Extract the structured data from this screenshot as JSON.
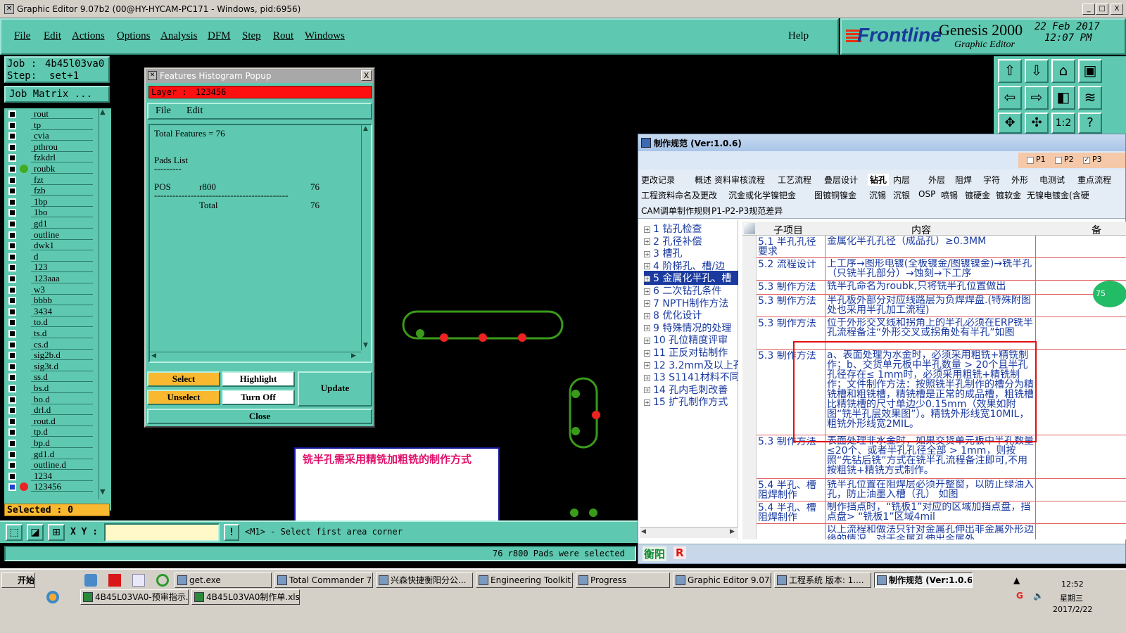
{
  "window": {
    "title": "Graphic Editor 9.07b2 (00@HY-HYCAM-PC171 - Windows, pid:6956)",
    "btn_min": "_",
    "btn_max": "□",
    "btn_close": "X"
  },
  "menu": [
    "File",
    "Edit",
    "Actions",
    "Options",
    "Analysis",
    "DFM",
    "Step",
    "Rout",
    "Windows"
  ],
  "help_label": "Help",
  "logo": {
    "brand": "Frontline",
    "product": "Genesis 2000",
    "subtitle": "Graphic Editor",
    "date": "22 Feb 2017",
    "time": "12:07 PM"
  },
  "job": {
    "job_label": "Job :",
    "job_value": "4b45l03va0",
    "step_label": "Step:",
    "step_value": "set+1",
    "matrix_button": "Job Matrix ..."
  },
  "layers": [
    {
      "name": "rout"
    },
    {
      "name": "tp"
    },
    {
      "name": "cvia"
    },
    {
      "name": "pthrou"
    },
    {
      "name": "fzkdrl"
    },
    {
      "name": "roubk",
      "dot": "#44aa22"
    },
    {
      "name": "fzt"
    },
    {
      "name": "fzb"
    },
    {
      "name": "1bp"
    },
    {
      "name": "1bo"
    },
    {
      "name": "gd1"
    },
    {
      "name": "outline"
    },
    {
      "name": "dwk1"
    },
    {
      "name": "d"
    },
    {
      "name": "123"
    },
    {
      "name": "123aaa"
    },
    {
      "name": "w3"
    },
    {
      "name": "bbbb"
    },
    {
      "name": "3434"
    },
    {
      "name": "to.d"
    },
    {
      "name": "ts.d"
    },
    {
      "name": "cs.d"
    },
    {
      "name": "sig2b.d"
    },
    {
      "name": "sig3t.d"
    },
    {
      "name": "ss.d"
    },
    {
      "name": "bs.d"
    },
    {
      "name": "bo.d"
    },
    {
      "name": "drl.d"
    },
    {
      "name": "rout.d"
    },
    {
      "name": "tp.d"
    },
    {
      "name": "bp.d"
    },
    {
      "name": "gd1.d"
    },
    {
      "name": "outline.d"
    },
    {
      "name": "1234"
    },
    {
      "name": "123456",
      "dot": "#ee2222",
      "active": true
    }
  ],
  "selected_label": "Selected : 0",
  "popup": {
    "title": "Features Histogram Popup",
    "close_x": "X",
    "layer_label": "Layer :",
    "layer_value": "123456",
    "menu_file": "File",
    "menu_edit": "Edit",
    "total_line": "Total Features = 76",
    "pads_list": "Pads List",
    "dash_short": "---------",
    "row_type": "POS",
    "row_sym": "r800",
    "row_count": "76",
    "dash_long": "--------------------------------------------",
    "total_label": "Total",
    "total_count": "76",
    "btn_select": "Select",
    "btn_highlight": "Highlight",
    "btn_update": "Update",
    "btn_unselect": "Unselect",
    "btn_turnoff": "Turn Off",
    "btn_close": "Close"
  },
  "annotation": "铣半孔需采用精铣加粗铣的制作方式",
  "bottom": {
    "xy_label": "X Y :",
    "excl": "!",
    "prompt": "<M1> - Select first area corner",
    "status": "76 r800 Pads were selected"
  },
  "spec": {
    "title": "制作规范 (Ver:1.0.6)",
    "p1": "P1",
    "p2": "P2",
    "p3": "P3",
    "tabs_row1": [
      "更改记录",
      "概述",
      "资料审核流程",
      "工艺流程",
      "叠层设计",
      "钻孔",
      "内层",
      "外层",
      "阻焊",
      "字符",
      "外形",
      "电测试",
      "重点流程"
    ],
    "tabs_row2": [
      "工程资料命名及更改",
      "沉金或化学镍钯金",
      "图镀铜镍金",
      "沉锡",
      "沉银",
      "OSP",
      "喷锡",
      "镀硬金",
      "镀软金",
      "无镍电镀金(含硬"
    ],
    "tabs_row3": [
      "CAM调单制作规则",
      "P1-P2-P3规范差异"
    ],
    "tree": [
      "1 钻孔检查",
      "2 孔径补偿",
      "3 槽孔",
      "4 阶梯孔、槽/边",
      "5 金属化半孔、槽",
      "6 二次钻孔条件",
      "7 NPTH制作方法",
      "8 优化设计",
      "9 特殊情况的处理",
      "10 孔位精度评审",
      "11 正反对钻制作",
      "12 3.2mm及以上孔",
      "13 S1141材料不同",
      "14 孔内毛刺改善",
      "15 扩孔制作方式"
    ],
    "col_sub": "子项目",
    "col_content": "内容",
    "col_note": "备",
    "rows": [
      {
        "sub": "5.1 半孔孔径要求",
        "content": "金属化半孔孔径（成品孔）≥0.3MM"
      },
      {
        "sub": "5.2 流程设计",
        "content": "上工序→图形电镀(全板镀金/图镀镍金)→铣半孔（只铣半孔部分）→蚀刻→下工序"
      },
      {
        "sub": "5.3 制作方法",
        "content": "铣半孔命名为roubk,只将铣半孔位置做出"
      },
      {
        "sub": "5.3 制作方法",
        "content": "半孔板外部分对应线路层为负焊焊盘.(特殊附图处也采用半孔加工流程)"
      },
      {
        "sub": "5.3 制作方法",
        "content": "位于外形交叉线和拐角上的半孔必须在ERP铣半孔流程备注“外形交叉或拐角处有半孔”如图"
      },
      {
        "sub": "5.3 制作方法",
        "content": "a、表面处理为水金时，必须采用粗铣+精铣制作；b、交货单元板中半孔数量 > 20个且半孔孔径存在≤ 1mm时，必须采用粗铣+精铣制作；文件制作方法：按照铣半孔制作的槽分为精铣槽和粗铣槽，精铣槽是正常的成品槽，粗铣槽比精铣槽的尺寸单边少0.15mm（效果如附图“铣半孔层效果图”）。精铣外形线宽10MIL，粗铣外形线宽2MIL。"
      },
      {
        "sub": "5.3 制作方法",
        "content": "表面处理非水金时，如果交货单元板中半孔数量≤20个、或者半孔孔径全部 > 1mm，则按照“先钻后铣”方式在铣半孔流程备注即可,不用按粗铣+精铣方式制作。"
      },
      {
        "sub": "5.4 半孔、槽阻焊制作",
        "content": "铣半孔位置在阻焊层必须开整窗，以防止绿油入孔，防止油墨入槽（孔） 如图"
      },
      {
        "sub": "5.4 半孔、槽阻焊制作",
        "content": "制作挡点时，“铣板1”对应的区域加挡点盘，挡点盘> “铣板1”区域4mil"
      },
      {
        "sub": "",
        "content": "以上流程和做法只针对金属孔伸出非金属外形边缘的情况，对于金属孔伸出金属外"
      }
    ],
    "status_city": "衡阳",
    "status_r": "R",
    "badge": "75"
  },
  "taskbar": {
    "start": "开始",
    "tasks_row1": [
      "get.exe",
      "Total Commander 7.0...",
      "兴森快捷衡阳分公...",
      "Engineering Toolkit 9....",
      "Progress",
      "Graphic Editor 9.07b2...",
      "工程系统 版本: 1....",
      "制作规范 (Ver:1.0.6)"
    ],
    "tasks_row2": [
      "4B45L03VA0-预审指示....",
      "4B45L03VA0制作单.xls ..."
    ],
    "clock_time": "12:52",
    "clock_day": "星期三",
    "clock_date": "2017/2/22"
  }
}
